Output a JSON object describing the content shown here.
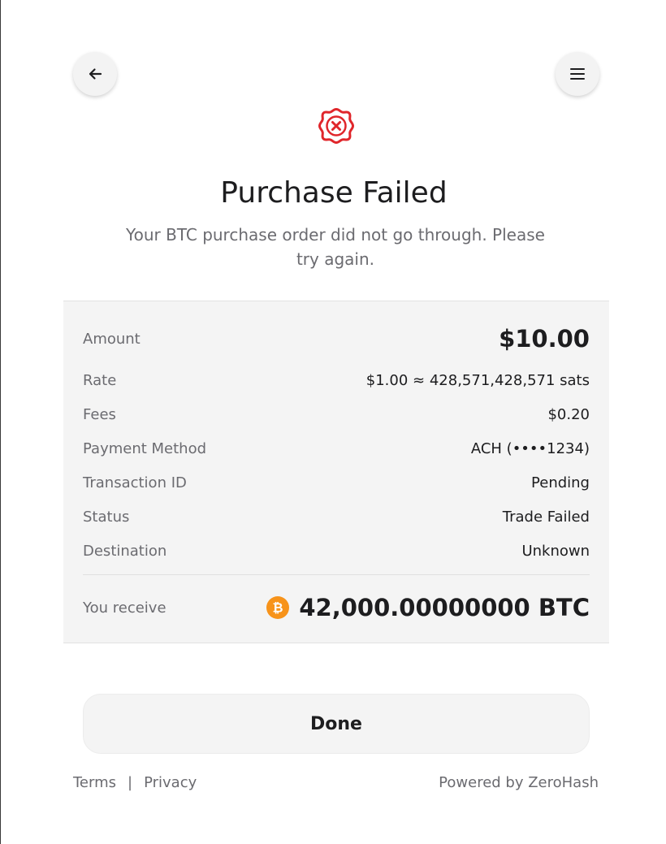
{
  "header": {
    "back_icon": "arrow-left-icon",
    "menu_icon": "hamburger-menu-icon"
  },
  "status": {
    "icon": "failed-badge-icon",
    "color": "#e0262b",
    "title": "Purchase Failed",
    "message": "Your BTC purchase order did not go through. Please try again."
  },
  "summary": {
    "amount": {
      "label": "Amount",
      "value": "$10.00"
    },
    "rate": {
      "label": "Rate",
      "value": "$1.00 ≈ 428,571,428,571 sats"
    },
    "fees": {
      "label": "Fees",
      "value": "$0.20"
    },
    "payment_method": {
      "label": "Payment Method",
      "value": "ACH (••••1234)"
    },
    "transaction_id": {
      "label": "Transaction ID",
      "value": "Pending"
    },
    "status": {
      "label": "Status",
      "value": "Trade Failed"
    },
    "destination": {
      "label": "Destination",
      "value": "Unknown"
    },
    "receive": {
      "label": "You receive",
      "icon": "bitcoin-icon",
      "icon_color": "#f7931a",
      "value": "42,000.00000000 BTC"
    }
  },
  "actions": {
    "done_label": "Done"
  },
  "footer": {
    "terms": "Terms",
    "separator": "|",
    "privacy": "Privacy",
    "powered_by": "Powered by ZeroHash"
  }
}
